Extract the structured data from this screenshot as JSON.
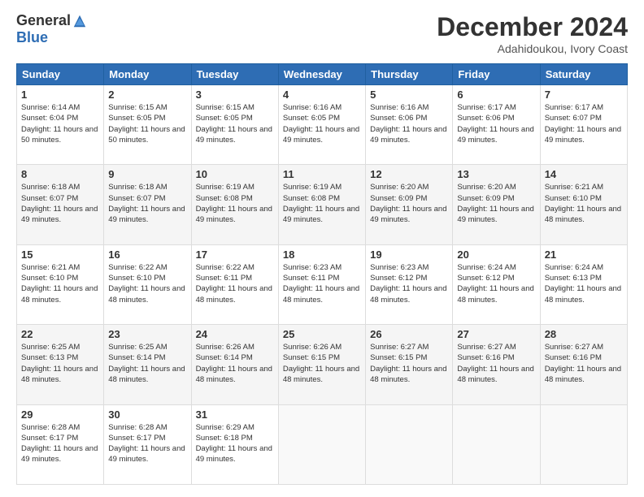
{
  "logo": {
    "general": "General",
    "blue": "Blue"
  },
  "header": {
    "title": "December 2024",
    "location": "Adahidoukou, Ivory Coast"
  },
  "weekdays": [
    "Sunday",
    "Monday",
    "Tuesday",
    "Wednesday",
    "Thursday",
    "Friday",
    "Saturday"
  ],
  "weeks": [
    [
      {
        "day": "1",
        "sunrise": "6:14 AM",
        "sunset": "6:04 PM",
        "daylight": "11 hours and 50 minutes."
      },
      {
        "day": "2",
        "sunrise": "6:15 AM",
        "sunset": "6:05 PM",
        "daylight": "11 hours and 50 minutes."
      },
      {
        "day": "3",
        "sunrise": "6:15 AM",
        "sunset": "6:05 PM",
        "daylight": "11 hours and 49 minutes."
      },
      {
        "day": "4",
        "sunrise": "6:16 AM",
        "sunset": "6:05 PM",
        "daylight": "11 hours and 49 minutes."
      },
      {
        "day": "5",
        "sunrise": "6:16 AM",
        "sunset": "6:06 PM",
        "daylight": "11 hours and 49 minutes."
      },
      {
        "day": "6",
        "sunrise": "6:17 AM",
        "sunset": "6:06 PM",
        "daylight": "11 hours and 49 minutes."
      },
      {
        "day": "7",
        "sunrise": "6:17 AM",
        "sunset": "6:07 PM",
        "daylight": "11 hours and 49 minutes."
      }
    ],
    [
      {
        "day": "8",
        "sunrise": "6:18 AM",
        "sunset": "6:07 PM",
        "daylight": "11 hours and 49 minutes."
      },
      {
        "day": "9",
        "sunrise": "6:18 AM",
        "sunset": "6:07 PM",
        "daylight": "11 hours and 49 minutes."
      },
      {
        "day": "10",
        "sunrise": "6:19 AM",
        "sunset": "6:08 PM",
        "daylight": "11 hours and 49 minutes."
      },
      {
        "day": "11",
        "sunrise": "6:19 AM",
        "sunset": "6:08 PM",
        "daylight": "11 hours and 49 minutes."
      },
      {
        "day": "12",
        "sunrise": "6:20 AM",
        "sunset": "6:09 PM",
        "daylight": "11 hours and 49 minutes."
      },
      {
        "day": "13",
        "sunrise": "6:20 AM",
        "sunset": "6:09 PM",
        "daylight": "11 hours and 49 minutes."
      },
      {
        "day": "14",
        "sunrise": "6:21 AM",
        "sunset": "6:10 PM",
        "daylight": "11 hours and 48 minutes."
      }
    ],
    [
      {
        "day": "15",
        "sunrise": "6:21 AM",
        "sunset": "6:10 PM",
        "daylight": "11 hours and 48 minutes."
      },
      {
        "day": "16",
        "sunrise": "6:22 AM",
        "sunset": "6:10 PM",
        "daylight": "11 hours and 48 minutes."
      },
      {
        "day": "17",
        "sunrise": "6:22 AM",
        "sunset": "6:11 PM",
        "daylight": "11 hours and 48 minutes."
      },
      {
        "day": "18",
        "sunrise": "6:23 AM",
        "sunset": "6:11 PM",
        "daylight": "11 hours and 48 minutes."
      },
      {
        "day": "19",
        "sunrise": "6:23 AM",
        "sunset": "6:12 PM",
        "daylight": "11 hours and 48 minutes."
      },
      {
        "day": "20",
        "sunrise": "6:24 AM",
        "sunset": "6:12 PM",
        "daylight": "11 hours and 48 minutes."
      },
      {
        "day": "21",
        "sunrise": "6:24 AM",
        "sunset": "6:13 PM",
        "daylight": "11 hours and 48 minutes."
      }
    ],
    [
      {
        "day": "22",
        "sunrise": "6:25 AM",
        "sunset": "6:13 PM",
        "daylight": "11 hours and 48 minutes."
      },
      {
        "day": "23",
        "sunrise": "6:25 AM",
        "sunset": "6:14 PM",
        "daylight": "11 hours and 48 minutes."
      },
      {
        "day": "24",
        "sunrise": "6:26 AM",
        "sunset": "6:14 PM",
        "daylight": "11 hours and 48 minutes."
      },
      {
        "day": "25",
        "sunrise": "6:26 AM",
        "sunset": "6:15 PM",
        "daylight": "11 hours and 48 minutes."
      },
      {
        "day": "26",
        "sunrise": "6:27 AM",
        "sunset": "6:15 PM",
        "daylight": "11 hours and 48 minutes."
      },
      {
        "day": "27",
        "sunrise": "6:27 AM",
        "sunset": "6:16 PM",
        "daylight": "11 hours and 48 minutes."
      },
      {
        "day": "28",
        "sunrise": "6:27 AM",
        "sunset": "6:16 PM",
        "daylight": "11 hours and 48 minutes."
      }
    ],
    [
      {
        "day": "29",
        "sunrise": "6:28 AM",
        "sunset": "6:17 PM",
        "daylight": "11 hours and 49 minutes."
      },
      {
        "day": "30",
        "sunrise": "6:28 AM",
        "sunset": "6:17 PM",
        "daylight": "11 hours and 49 minutes."
      },
      {
        "day": "31",
        "sunrise": "6:29 AM",
        "sunset": "6:18 PM",
        "daylight": "11 hours and 49 minutes."
      },
      null,
      null,
      null,
      null
    ]
  ],
  "labels": {
    "sunrise": "Sunrise: ",
    "sunset": "Sunset: ",
    "daylight": "Daylight: "
  }
}
